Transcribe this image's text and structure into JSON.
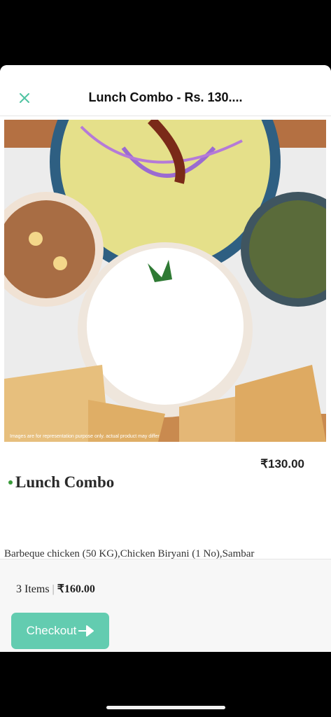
{
  "header": {
    "title": "Lunch Combo - Rs. 130....",
    "close_icon": "close-icon"
  },
  "product": {
    "image_caption": "Images are for representation purpose only. actual product may differ",
    "price": "₹130.00",
    "name": "Lunch Combo",
    "description": "Barbeque chicken (50 KG),Chicken Biryani (1 No),Sambar"
  },
  "cart": {
    "items_count": "3 Items",
    "separator": "|",
    "total": "₹160.00",
    "checkout_label": "Checkout"
  },
  "colors": {
    "accent": "#63ccb0",
    "close_icon": "#4fc3a1",
    "veg_dot": "#3a9b3a"
  }
}
